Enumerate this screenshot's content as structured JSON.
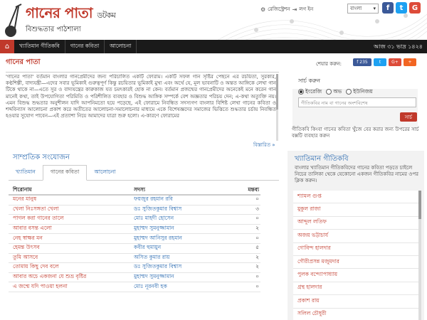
{
  "header": {
    "title": "গানের পাতা",
    "dotcom": "ডটকম",
    "tagline": "বিশুদ্ধতার পাঠশালা",
    "links": [
      "রেজিস্ট্রেশন",
      "লগ ইন"
    ],
    "language": "বাংলা",
    "social": [
      {
        "name": "facebook",
        "glyph": "f",
        "color": "#3b5998"
      },
      {
        "name": "twitter",
        "glyph": "t",
        "color": "#1da1f2"
      },
      {
        "name": "google-plus",
        "glyph": "G",
        "color": "#dd4b39"
      }
    ]
  },
  "nav": {
    "items": [
      "খ্যাতিমান গীতিকবি",
      "গানের কবিতা",
      "আলোচনা"
    ],
    "date": "আজ ৩১ ভাদ্র ১৪২৪"
  },
  "main": {
    "title": "গানের পাতা",
    "share_label": "শেয়ার করুন:",
    "share_buttons": [
      {
        "name": "facebook",
        "label": "f 235",
        "color": "#3b5998"
      },
      {
        "name": "twitter",
        "label": "t",
        "color": "#1da1f2"
      },
      {
        "name": "google-plus",
        "label": "G+",
        "color": "#dd4b39"
      },
      {
        "name": "more",
        "label": "+",
        "color": "#f26522"
      }
    ],
    "intro": "'গানের পাতা' বর্তমান বাংলার গানপ্রেমীদের জন্য পরিচালিত একটি ফোরাম। একটি সফল গান সৃষ্টির পেছনে এর রচয়িতা, সুরকার, কণ্ঠশিল্পী, বাদ্যযন্ত্রী—এদের সবার ভূমিকাই গুরুত্বপূর্ণ কিন্তু রচয়িতার ভূমিকাই মুখ্য এবং অর্থে যে, মূল ভাবনাটি ও অন্তত আঙ্গিকে লেখা গান টিকে থাকে না—এতে সুর ও বাদ্যযন্ত্রের কারুকাজ যত চমৎকারই হোক না কেন। বর্তমান প্রজন্মের গানপ্রেমীদের অনেকেই মনে করেন গান মানেই কথা, তাই উপযোগিতা পরিমিতি ও পরিশীলিত ব্যবহার ও বিশুদ্ধ আঙ্গিক সম্পর্কে বেশ অজ্ঞতার পরিচয় দেন; এ-কথা অত্যুক্তি নয়। এমন বিশুদ্ধ শুদ্ধতার অনুশীলন যাদি আপনিমতো হয়ে পড়েছে, এই ফোরামে নিবন্ধিত সদস্যগণ বাংলার বিশিষ্ট লেখা গানের কবিতা ও শব্দবিন্যাস আলোচনা প্রকাশ করে অতীতের আলোচনা-সমালোচনার মাধ্যমে একে বিশেষজ্ঞদের সমাজের ভিত্তিতে শুদ্ধতার চর্চায় নিবন্ধিত হওয়ার সুযোগ পাবেন—এই প্রত্যাশা নিয়ে আমাদের যাত্রা শুরু হলো। এ-কারণে ফোরামের",
    "more": "বিস্তারিত »",
    "recent_title": "সাম্প্রতিক সংযোজন",
    "tabs": [
      "খ্যাতিমান",
      "গানের কবিতা",
      "আলোচনা"
    ],
    "table": {
      "headers": [
        "শিরোনাম",
        "সদস্য",
        "মন্তব্য"
      ],
      "rows": [
        [
          "মনের মানুষ",
          "ফয়জুর রহমান রবি",
          "০"
        ],
        [
          "খেলা নিঃসঙ্গতা খেলা",
          "ডঃ সুজিতকুমার বিশ্বাস",
          "৩"
        ],
        [
          "পাগল করা গানের তালে",
          "মোঃ মাহদী হোসেন",
          "০"
        ],
        [
          "আবার বসন্ত এলো",
          "মুহাম্মদ সুমনুজ্জামান",
          "২"
        ],
        [
          "নেহ স্বাক্ষর মন",
          "মুহাম্মদ আনিসুর রহমান",
          "০"
        ],
        [
          "হেমন্ত উৎসব",
          "কবীর হুমায়ুন",
          "৫"
        ],
        [
          "তুমি আসবে",
          "অসিত কুমার রায়",
          "২"
        ],
        [
          "তোমায় কিছু দেব বলে",
          "ডঃ সুজিতকুমার বিশ্বাস",
          "২"
        ],
        [
          "আবার অচে একজনা যে শুভ্র বৃষ্টির",
          "মুহাম্মদ সুমনুজ্জামান",
          "০"
        ],
        [
          "এ জন্মে যদি পাওয়া হলনা",
          "মোঃ নূরনবী হক",
          "০"
        ]
      ]
    }
  },
  "search": {
    "title": "সার্চ করুন",
    "options": [
      "ইংরেজি",
      "অভ",
      "ইউনিজয়"
    ],
    "selected": 0,
    "placeholder": "গীতিকবির নাম বা গানের অংশবিশেষ",
    "button": "সার্চ",
    "help": "গীতিকবি কিংবা গানের কবিতা খুঁজে বের করার জন্য উপরের সার্চ বক্সটি ব্যবহার করুন"
  },
  "sidebar": {
    "title": "খ্যাতিমান গীতিকবি",
    "desc": "বাংলার খ্যাতিমান গীতিকবিদের গানের কবিতা পড়তে চাইলে নিচের তালিকা থেকে যেকোনো একজন গীতিকবির নামের ওপর ক্লিক করুন।",
    "items": [
      "শ্যামল গুপ্ত",
      "মুকুল রাজা",
      "আব্দুল লতিফ",
      "অজয় ভট্টাচার্য",
      "গোবিন্দ হালদার",
      "গৌরীপ্রসন্ন মজুমদার",
      "পুলক বন্দ্যোপাধ্যায়",
      "গ্ৰন্থ হালদার",
      "প্রকাশ রায়",
      "সলিল চৌধুরী"
    ]
  }
}
